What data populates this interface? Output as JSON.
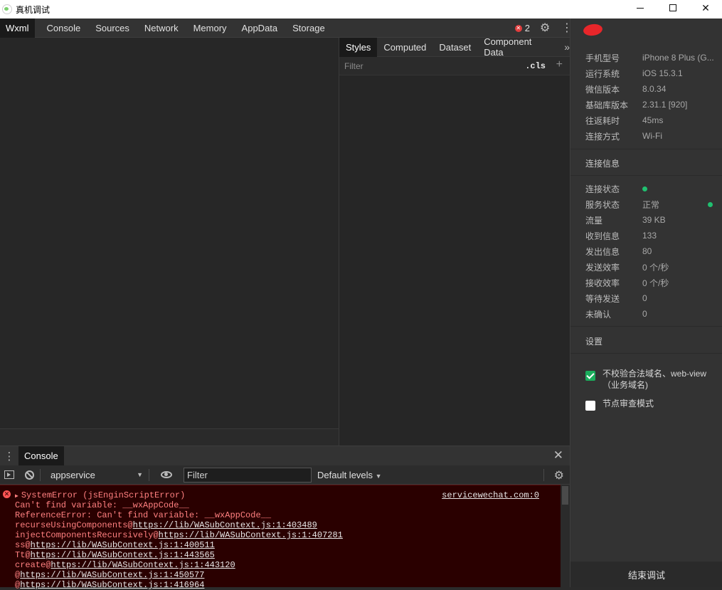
{
  "window": {
    "title": "真机调试"
  },
  "toptabs": [
    "Wxml",
    "Console",
    "Sources",
    "Network",
    "Memory",
    "AppData",
    "Storage"
  ],
  "error_count": "2",
  "styles": {
    "tabs": [
      "Styles",
      "Computed",
      "Dataset",
      "Component Data"
    ],
    "filter_placeholder": "Filter",
    "cls_label": ".cls"
  },
  "drawer": {
    "tab": "Console",
    "context": "appservice",
    "filter_placeholder": "Filter",
    "levels": "Default levels"
  },
  "console": {
    "error_title": "SystemError (jsEnginScriptError)",
    "error_source": "servicewechat.com:0",
    "message_lines": [
      "Can't find variable: __wxAppCode__",
      "ReferenceError: Can't find variable: __wxAppCode__"
    ],
    "stack": [
      {
        "fn": "recurseUsingComponents@",
        "link": "https://lib/WASubContext.js:1:403489"
      },
      {
        "fn": "injectComponentsRecursively@",
        "link": "https://lib/WASubContext.js:1:407281"
      },
      {
        "fn": "ss@",
        "link": "https://lib/WASubContext.js:1:400511"
      },
      {
        "fn": "Tt@",
        "link": "https://lib/WASubContext.js:1:443565"
      },
      {
        "fn": "create@",
        "link": "https://lib/WASubContext.js:1:443120"
      },
      {
        "fn": "@",
        "link": "https://lib/WASubContext.js:1:450577"
      },
      {
        "fn": "@",
        "link": "https://lib/WASubContext.js:1:416964"
      }
    ]
  },
  "device": [
    {
      "label": "手机型号",
      "value": "iPhone 8 Plus (G..."
    },
    {
      "label": "运行系统",
      "value": "iOS 15.3.1"
    },
    {
      "label": "微信版本",
      "value": "8.0.34"
    },
    {
      "label": "基础库版本",
      "value": "2.31.1 [920]"
    },
    {
      "label": "往返耗时",
      "value": "45ms"
    },
    {
      "label": "连接方式",
      "value": "Wi-Fi"
    }
  ],
  "connection_title": "连接信息",
  "connection": [
    {
      "label": "连接状态",
      "value": ""
    },
    {
      "label": "服务状态",
      "value": "正常"
    },
    {
      "label": "流量",
      "value": "39 KB"
    },
    {
      "label": "收到信息",
      "value": "133"
    },
    {
      "label": "发出信息",
      "value": "80"
    },
    {
      "label": "发送效率",
      "value": "0 个/秒"
    },
    {
      "label": "接收效率",
      "value": "0 个/秒"
    },
    {
      "label": "等待发送",
      "value": "0"
    },
    {
      "label": "未确认",
      "value": "0"
    }
  ],
  "settings_title": "设置",
  "settings": [
    {
      "label": "不校验合法域名、web-view（业务域名)",
      "checked": true
    },
    {
      "label": "节点审查模式",
      "checked": false
    }
  ],
  "end_button": "结束调试",
  "colors": {
    "accent_green": "#1aad5c",
    "status_green": "#20c070",
    "error_red": "#e23d3d"
  }
}
